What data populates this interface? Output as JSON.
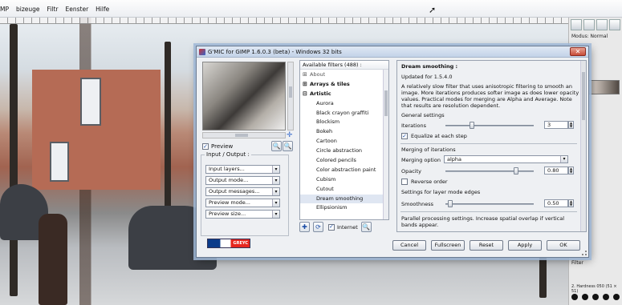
{
  "gimp": {
    "menu": [
      "MP",
      "bizeuge",
      "Filtr",
      "Eenster",
      "Hilfe"
    ],
    "dock_mode": "Modus: Normal",
    "dock_brush_info": "2. Hardness 050 (51 × 51)",
    "dock_filter_label": "Filter"
  },
  "dialog": {
    "title": "G'MIC for GIMP 1.6.0.3 (beta) - Windows 32 bits",
    "close": "✕",
    "preview_label": "Preview",
    "preview_checked": true,
    "input_output": {
      "title": "Input / Output :",
      "selects": [
        "Input layers...",
        "Output mode...",
        "Output messages...",
        "Preview mode...",
        "Preview size..."
      ]
    },
    "logo_text": "GREYC",
    "filters": {
      "header": "Available filters (488) :",
      "rows": [
        {
          "label": "About",
          "type": "cat",
          "expand": "⊞",
          "style": "faint"
        },
        {
          "label": "Arrays & tiles",
          "type": "cat",
          "expand": "⊞",
          "style": "bold"
        },
        {
          "label": "Artistic",
          "type": "cat",
          "expand": "⊟",
          "style": "bold"
        },
        {
          "label": "Aurora",
          "type": "item"
        },
        {
          "label": "Black crayon graffiti",
          "type": "item"
        },
        {
          "label": "Blockism",
          "type": "item"
        },
        {
          "label": "Bokeh",
          "type": "item"
        },
        {
          "label": "Cartoon",
          "type": "item"
        },
        {
          "label": "Circle abstraction",
          "type": "item"
        },
        {
          "label": "Colored pencils",
          "type": "item"
        },
        {
          "label": "Color abstraction paint",
          "type": "item"
        },
        {
          "label": "Cubism",
          "type": "item"
        },
        {
          "label": "Cutout",
          "type": "item"
        },
        {
          "label": "Dream smoothing",
          "type": "item",
          "selected": true
        },
        {
          "label": "Ellipsionism",
          "type": "item"
        }
      ],
      "internet_label": "Internet",
      "internet_checked": true
    },
    "params": {
      "title": "Dream smoothing :",
      "updated": "Updated for 1.5.4.0",
      "description": "A relatively slow filter that uses anisotropic filtering to smooth an image. More iterations produces softer image as does lower opacity values. Practical modes for merging are Alpha and Average. Note that results are resolution dependent.",
      "general_settings": "General settings",
      "iterations_label": "Iterations",
      "iterations_value": "3",
      "iterations_fraction": 0.3,
      "equalize_label": "Equalize at each step",
      "equalize_checked": true,
      "merging_title": "Merging of iterations",
      "merging_label": "Merging option",
      "merging_value": "alpha",
      "opacity_label": "Opacity",
      "opacity_value": "0.80",
      "opacity_fraction": 0.8,
      "reverse_label": "Reverse order",
      "reverse_checked": false,
      "layer_mode_title": "Settings for layer mode edges",
      "smoothness_label": "Smoothness",
      "smoothness_value": "0.50",
      "smoothness_fraction": 0.05,
      "parallel_text": "Parallel processing settings. Increase spatial overlap if vertical bands appear."
    },
    "buttons": {
      "cancel": "Cancel",
      "fullscreen": "Fullscreen",
      "reset": "Reset",
      "apply": "Apply",
      "ok": "OK"
    }
  }
}
